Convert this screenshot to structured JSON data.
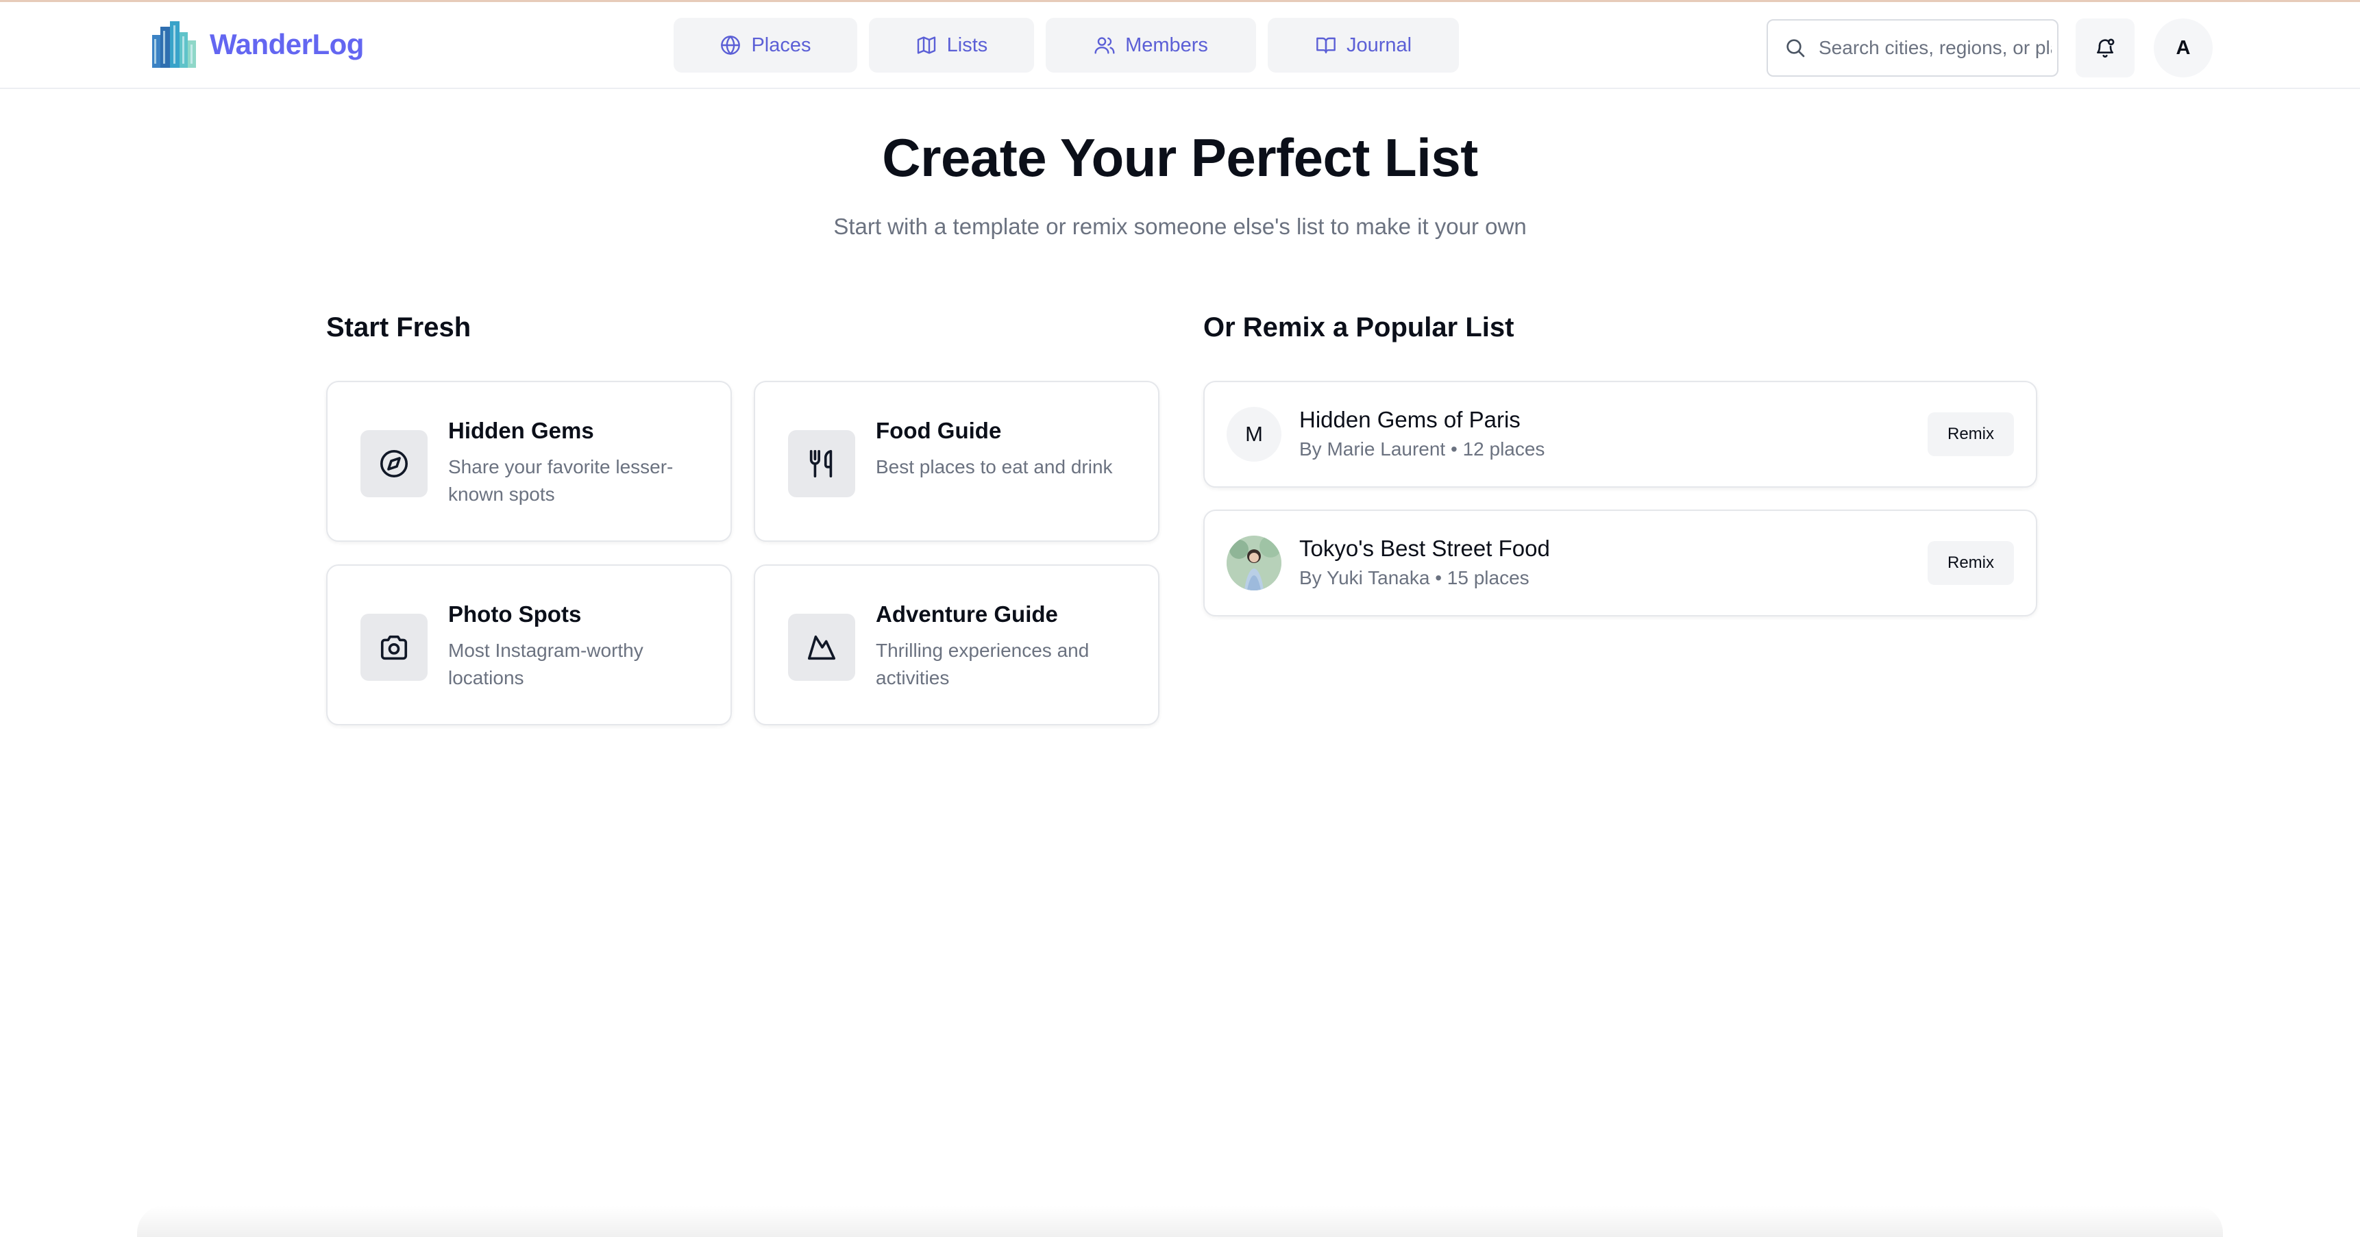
{
  "app": {
    "name": "WanderLog",
    "accent_color": "#6366f1"
  },
  "header": {
    "nav": [
      {
        "label": "Places",
        "icon": "globe-icon"
      },
      {
        "label": "Lists",
        "icon": "map-icon"
      },
      {
        "label": "Members",
        "icon": "users-icon"
      },
      {
        "label": "Journal",
        "icon": "book-icon"
      }
    ],
    "search": {
      "placeholder": "Search cities, regions, or places",
      "value": ""
    },
    "notifications_icon": "bell-icon",
    "avatar_initial": "A"
  },
  "hero": {
    "title": "Create Your Perfect List",
    "subtitle": "Start with a template or remix someone else's list to make it your own"
  },
  "start_fresh": {
    "heading": "Start Fresh",
    "templates": [
      {
        "title": "Hidden Gems",
        "description": "Share your favorite lesser-known spots",
        "icon": "compass-icon"
      },
      {
        "title": "Food Guide",
        "description": "Best places to eat and drink",
        "icon": "utensils-icon"
      },
      {
        "title": "Photo Spots",
        "description": "Most Instagram-worthy locations",
        "icon": "camera-icon"
      },
      {
        "title": "Adventure Guide",
        "description": "Thrilling experiences and activities",
        "icon": "mountain-icon"
      }
    ]
  },
  "remix": {
    "heading": "Or Remix a Popular List",
    "lists": [
      {
        "title": "Hidden Gems of Paris",
        "meta": "By Marie Laurent • 12 places",
        "avatar_initial": "M",
        "button": "Remix"
      },
      {
        "title": "Tokyo's Best Street Food",
        "meta": "By Yuki Tanaka • 15 places",
        "avatar_initial": "",
        "button": "Remix"
      }
    ]
  }
}
